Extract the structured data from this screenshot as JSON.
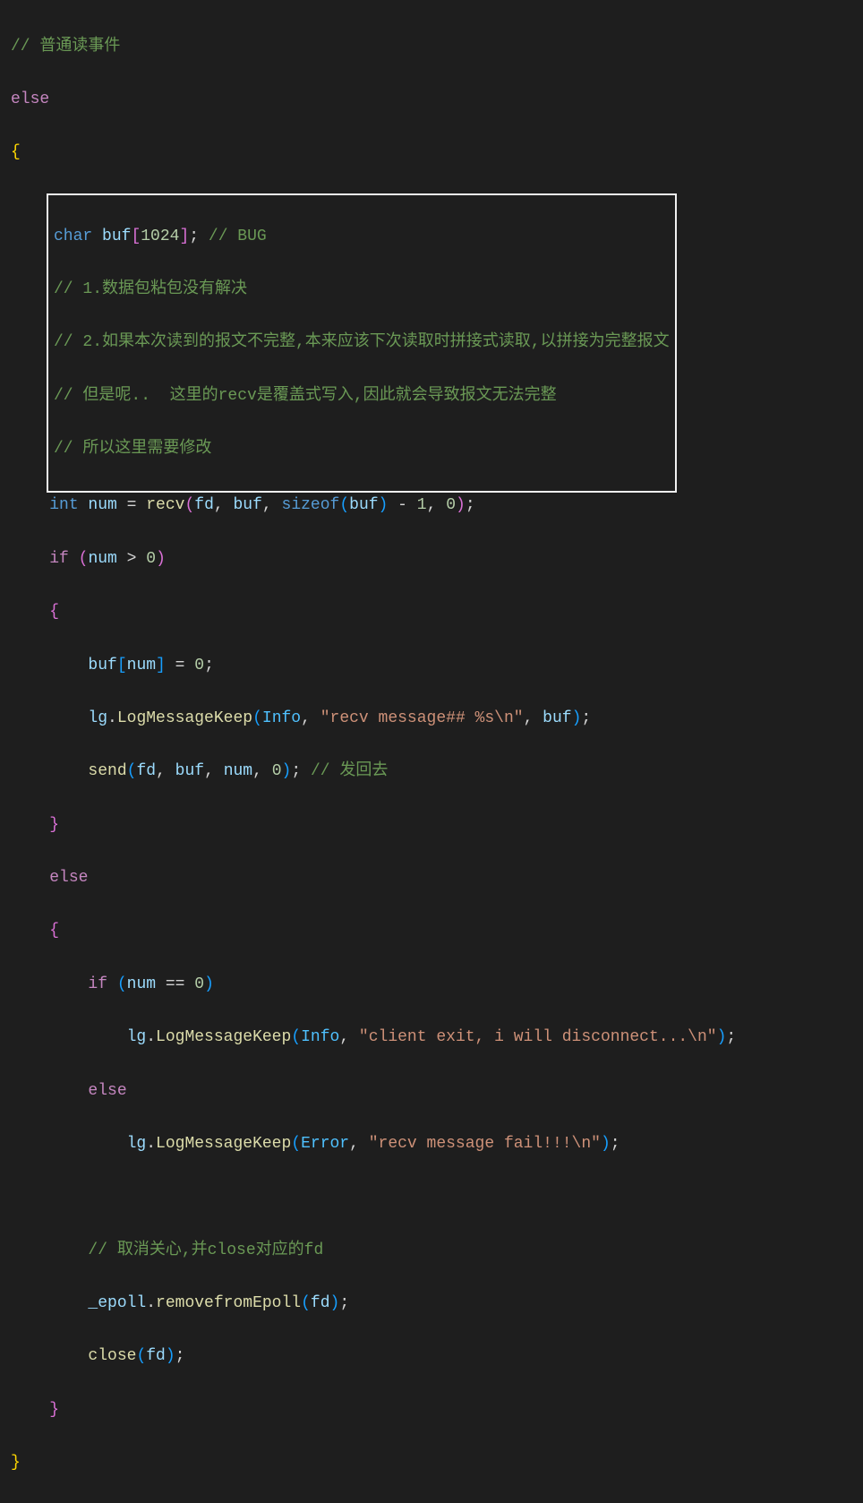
{
  "code": {
    "line1_comment": "// 普通读事件",
    "line2_else": "else",
    "line3_brace": "{",
    "box": {
      "l1_pre": "char",
      "l1_buf": " buf",
      "l1_bracket_open": "[",
      "l1_num": "1024",
      "l1_bracket_close": "]",
      "l1_semi": "; ",
      "l1_comment": "// BUG",
      "l2": "// 1.数据包粘包没有解决",
      "l3": "// 2.如果本次读到的报文不完整,本来应该下次读取时拼接式读取,以拼接为完整报文",
      "l4": "// 但是呢..  这里的recv是覆盖式写入,因此就会导致报文无法完整",
      "l5": "// 所以这里需要修改"
    },
    "recv": {
      "int": "int",
      "num": " num ",
      "eq": "= ",
      "recv": "recv",
      "paren_open": "(",
      "fd": "fd",
      "comma1": ", ",
      "buf": "buf",
      "comma2": ", ",
      "sizeof": "sizeof",
      "paren2_open": "(",
      "buf2": "buf",
      "paren2_close": ")",
      "minus": " - ",
      "one": "1",
      "comma3": ", ",
      "zero": "0",
      "paren_close": ")",
      "semi": ";"
    },
    "if1": {
      "if": "if",
      "space": " ",
      "paren_open": "(",
      "num": "num ",
      "gt": "> ",
      "zero": "0",
      "paren_close": ")"
    },
    "brace_open1": "{",
    "assign": {
      "buf": "buf",
      "bracket_open": "[",
      "num": "num",
      "bracket_close": "]",
      "eq": " = ",
      "zero": "0",
      "semi": ";"
    },
    "log1": {
      "lg": "lg",
      "dot": ".",
      "fn": "LogMessageKeep",
      "paren_open": "(",
      "info": "Info",
      "comma1": ", ",
      "str": "\"recv message## %s\\n\"",
      "comma2": ", ",
      "buf": "buf",
      "paren_close": ")",
      "semi": ";"
    },
    "send": {
      "fn": "send",
      "paren_open": "(",
      "fd": "fd",
      "comma1": ", ",
      "buf": "buf",
      "comma2": ", ",
      "num": "num",
      "comma3": ", ",
      "zero": "0",
      "paren_close": ")",
      "semi": "; ",
      "comment": "// 发回去"
    },
    "brace_close1": "}",
    "else2": "else",
    "brace_open2": "{",
    "if2": {
      "if": "if",
      "space": " ",
      "paren_open": "(",
      "num": "num ",
      "eq": "== ",
      "zero": "0",
      "paren_close": ")"
    },
    "log2": {
      "lg": "lg",
      "dot": ".",
      "fn": "LogMessageKeep",
      "paren_open": "(",
      "info": "Info",
      "comma": ", ",
      "str": "\"client exit, i will disconnect...\\n\"",
      "paren_close": ")",
      "semi": ";"
    },
    "else3": "else",
    "log3": {
      "lg": "lg",
      "dot": ".",
      "fn": "LogMessageKeep",
      "paren_open": "(",
      "error": "Error",
      "comma": ", ",
      "str": "\"recv message fail!!!\\n\"",
      "paren_close": ")",
      "semi": ";"
    },
    "comment_cancel": "// 取消关心,并close对应的fd",
    "epoll": {
      "obj": "_epoll",
      "dot": ".",
      "fn": "removefromEpoll",
      "paren_open": "(",
      "fd": "fd",
      "paren_close": ")",
      "semi": ";"
    },
    "close": {
      "fn": "close",
      "paren_open": "(",
      "fd": "fd",
      "paren_close": ")",
      "semi": ";"
    },
    "brace_close2": "}",
    "brace_close3": "}"
  }
}
